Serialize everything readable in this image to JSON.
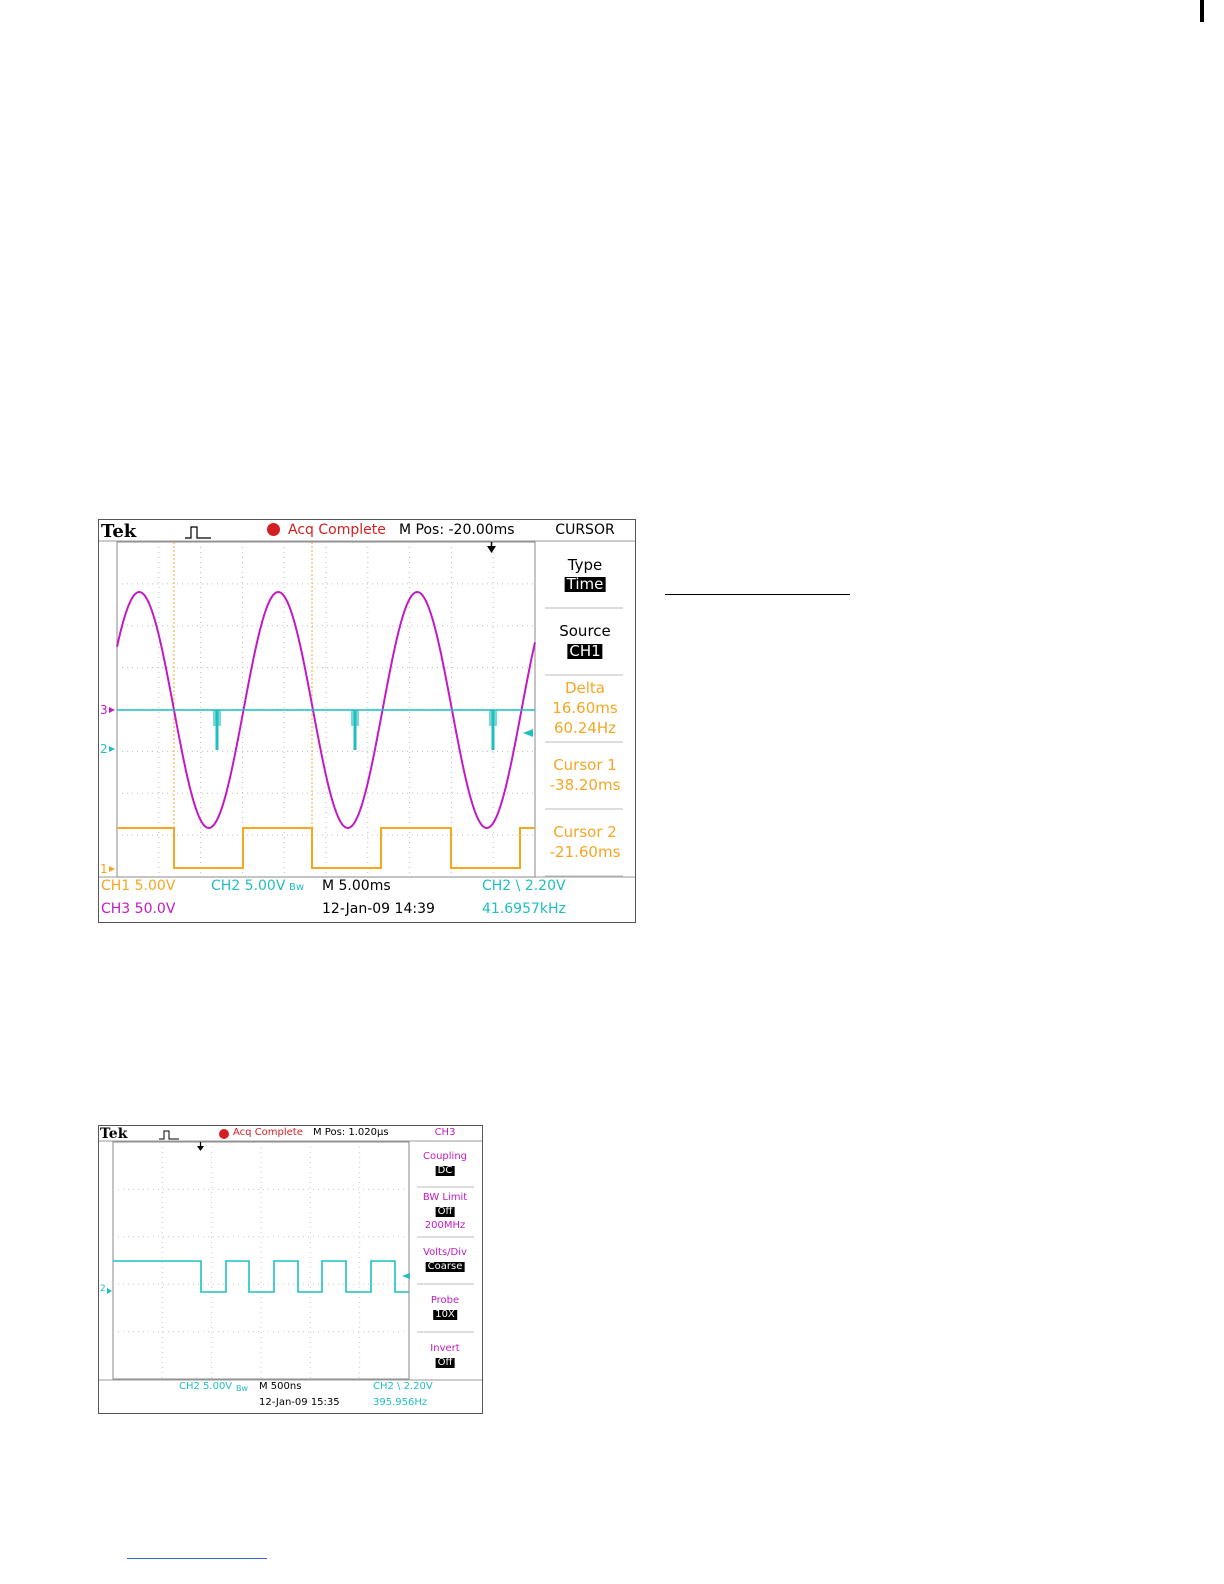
{
  "scope1": {
    "brand": "Tek",
    "status": "Acq Complete",
    "mpos": "M Pos: -20.00ms",
    "menu_title": "CURSOR",
    "menu": [
      {
        "label": "Type",
        "value": "Time",
        "value_style": "badge",
        "color": "#000000"
      },
      {
        "label": "Source",
        "value": "CH1",
        "value_style": "badge",
        "color": "#000000"
      },
      {
        "label": "Delta",
        "value": "16.60ms",
        "value2": "60.24Hz",
        "value_style": "plain",
        "color": "#f5a623"
      },
      {
        "label": "Cursor 1",
        "value": "-38.20ms",
        "value_style": "plain",
        "color": "#f5a623"
      },
      {
        "label": "Cursor 2",
        "value": "-21.60ms",
        "value_style": "plain",
        "color": "#f5a623"
      }
    ],
    "footer": {
      "ch1": "CH1  5.00V",
      "ch2": "CH2  5.00V",
      "bw": "Bw",
      "timebase": "M 5.00ms",
      "trigger": "CH2 \\ 2.20V",
      "ch3": "CH3  50.0V",
      "date": "12-Jan-09 14:39",
      "freq": "41.6957kHz"
    },
    "markers": {
      "ch3": "3",
      "ch2": "2",
      "ch1": "1"
    },
    "colors": {
      "ch1": "#f5a623",
      "ch2": "#1fbfbf",
      "ch3": "#c21bc2",
      "status": "#d42020",
      "grid": "#bdbdbd"
    }
  },
  "scope2": {
    "brand": "Tek",
    "status": "Acq Complete",
    "mpos": "M Pos: 1.020μs",
    "menu_title": "CH3",
    "menu": [
      {
        "label": "Coupling",
        "value": "DC"
      },
      {
        "label": "BW Limit",
        "value": "Off",
        "extra": "200MHz"
      },
      {
        "label": "Volts/Div",
        "value": "Coarse"
      },
      {
        "label": "Probe",
        "value": "10X"
      },
      {
        "label": "Invert",
        "value": "Off"
      }
    ],
    "footer": {
      "ch2": "CH2  5.00V",
      "bw": "Bw",
      "timebase": "M 500ns",
      "trigger": "CH2 \\ 2.20V",
      "date": "12-Jan-09 15:35",
      "freq": "395.956Hz"
    },
    "markers": {
      "ch2": "2"
    },
    "colors": {
      "ch2": "#1fbfbf",
      "menu": "#c21bc2",
      "status": "#d42020"
    }
  }
}
